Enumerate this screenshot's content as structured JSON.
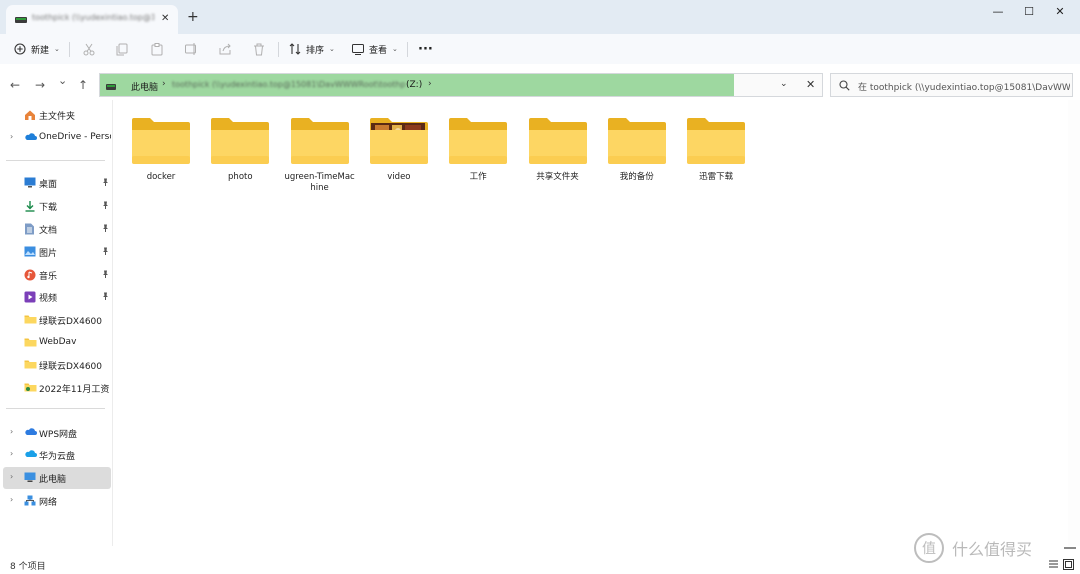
{
  "window": {
    "tab_title": "toothpick (\\\\yudexintiao.top@15081\\DavWWWRoot) (Z:)",
    "new_tab_symbol": "+",
    "tab_close_symbol": "✕",
    "minimize_symbol": "—",
    "maximize_symbol": "☐",
    "close_symbol": "✕"
  },
  "toolbar": {
    "new_label": "新建",
    "sort_label": "排序",
    "view_label": "查看",
    "more_symbol": "···"
  },
  "nav": {
    "back_symbol": "←",
    "forward_symbol": "→",
    "recent_symbol": "⌄",
    "up_symbol": "↑"
  },
  "address": {
    "root": "此电脑",
    "path_obscured": "toothpick (\\\\yudexintiao.top@15081\\DavWWWRoot\\toothpick)",
    "drive_label": "(Z:)",
    "separator": "›",
    "dropdown_symbol": "⌄",
    "clear_symbol": "✕",
    "highlight_color": "#9ed8a0"
  },
  "search": {
    "placeholder": "在 toothpick (\\\\yudexintiao.top@15081\\DavWWW..."
  },
  "sidebar": {
    "items": [
      {
        "label": "主文件夹",
        "icon": "home-icon",
        "expander": false,
        "pinned": false
      },
      {
        "label": "OneDrive - Personal",
        "icon": "onedrive-icon",
        "expander": true,
        "pinned": false
      },
      {
        "label": "桌面",
        "icon": "desktop-icon",
        "expander": false,
        "pinned": true
      },
      {
        "label": "下载",
        "icon": "download-icon",
        "expander": false,
        "pinned": true
      },
      {
        "label": "文档",
        "icon": "documents-icon",
        "expander": false,
        "pinned": true
      },
      {
        "label": "图片",
        "icon": "pictures-icon",
        "expander": false,
        "pinned": true
      },
      {
        "label": "音乐",
        "icon": "music-icon",
        "expander": false,
        "pinned": true
      },
      {
        "label": "视频",
        "icon": "videos-icon",
        "expander": false,
        "pinned": true
      },
      {
        "label": "绿联云DX4600",
        "icon": "folder-icon",
        "expander": false,
        "pinned": false
      },
      {
        "label": "WebDav",
        "icon": "folder-icon",
        "expander": false,
        "pinned": false
      },
      {
        "label": "绿联云DX4600",
        "icon": "folder-icon",
        "expander": false,
        "pinned": false
      },
      {
        "label": "2022年11月工资",
        "icon": "folder-shared-icon",
        "expander": false,
        "pinned": false
      },
      {
        "label": "WPS网盘",
        "icon": "wps-cloud-icon",
        "expander": true,
        "pinned": false
      },
      {
        "label": "华为云盘",
        "icon": "huawei-cloud-icon",
        "expander": true,
        "pinned": false
      },
      {
        "label": "此电脑",
        "icon": "this-pc-icon",
        "expander": true,
        "pinned": false,
        "selected": true
      },
      {
        "label": "网络",
        "icon": "network-icon",
        "expander": true,
        "pinned": false
      }
    ],
    "pin_symbol": "📌",
    "expander_symbol": "›"
  },
  "files": [
    {
      "name": "docker",
      "type": "folder"
    },
    {
      "name": "photo",
      "type": "folder"
    },
    {
      "name": "ugreen-TimeMachine",
      "type": "folder"
    },
    {
      "name": "video",
      "type": "folder-with-preview"
    },
    {
      "name": "工作",
      "type": "folder"
    },
    {
      "name": "共享文件夹",
      "type": "folder"
    },
    {
      "name": "我的备份",
      "type": "folder"
    },
    {
      "name": "迅雷下载",
      "type": "folder"
    }
  ],
  "status": {
    "item_count": "8 个项目"
  },
  "watermark": {
    "text": "什么值得买"
  },
  "colors": {
    "folder_back": "#e9b122",
    "folder_front": "#fdd663",
    "folder_front_bottom": "#f8c43c",
    "selected_bg": "#dcdcdc"
  }
}
